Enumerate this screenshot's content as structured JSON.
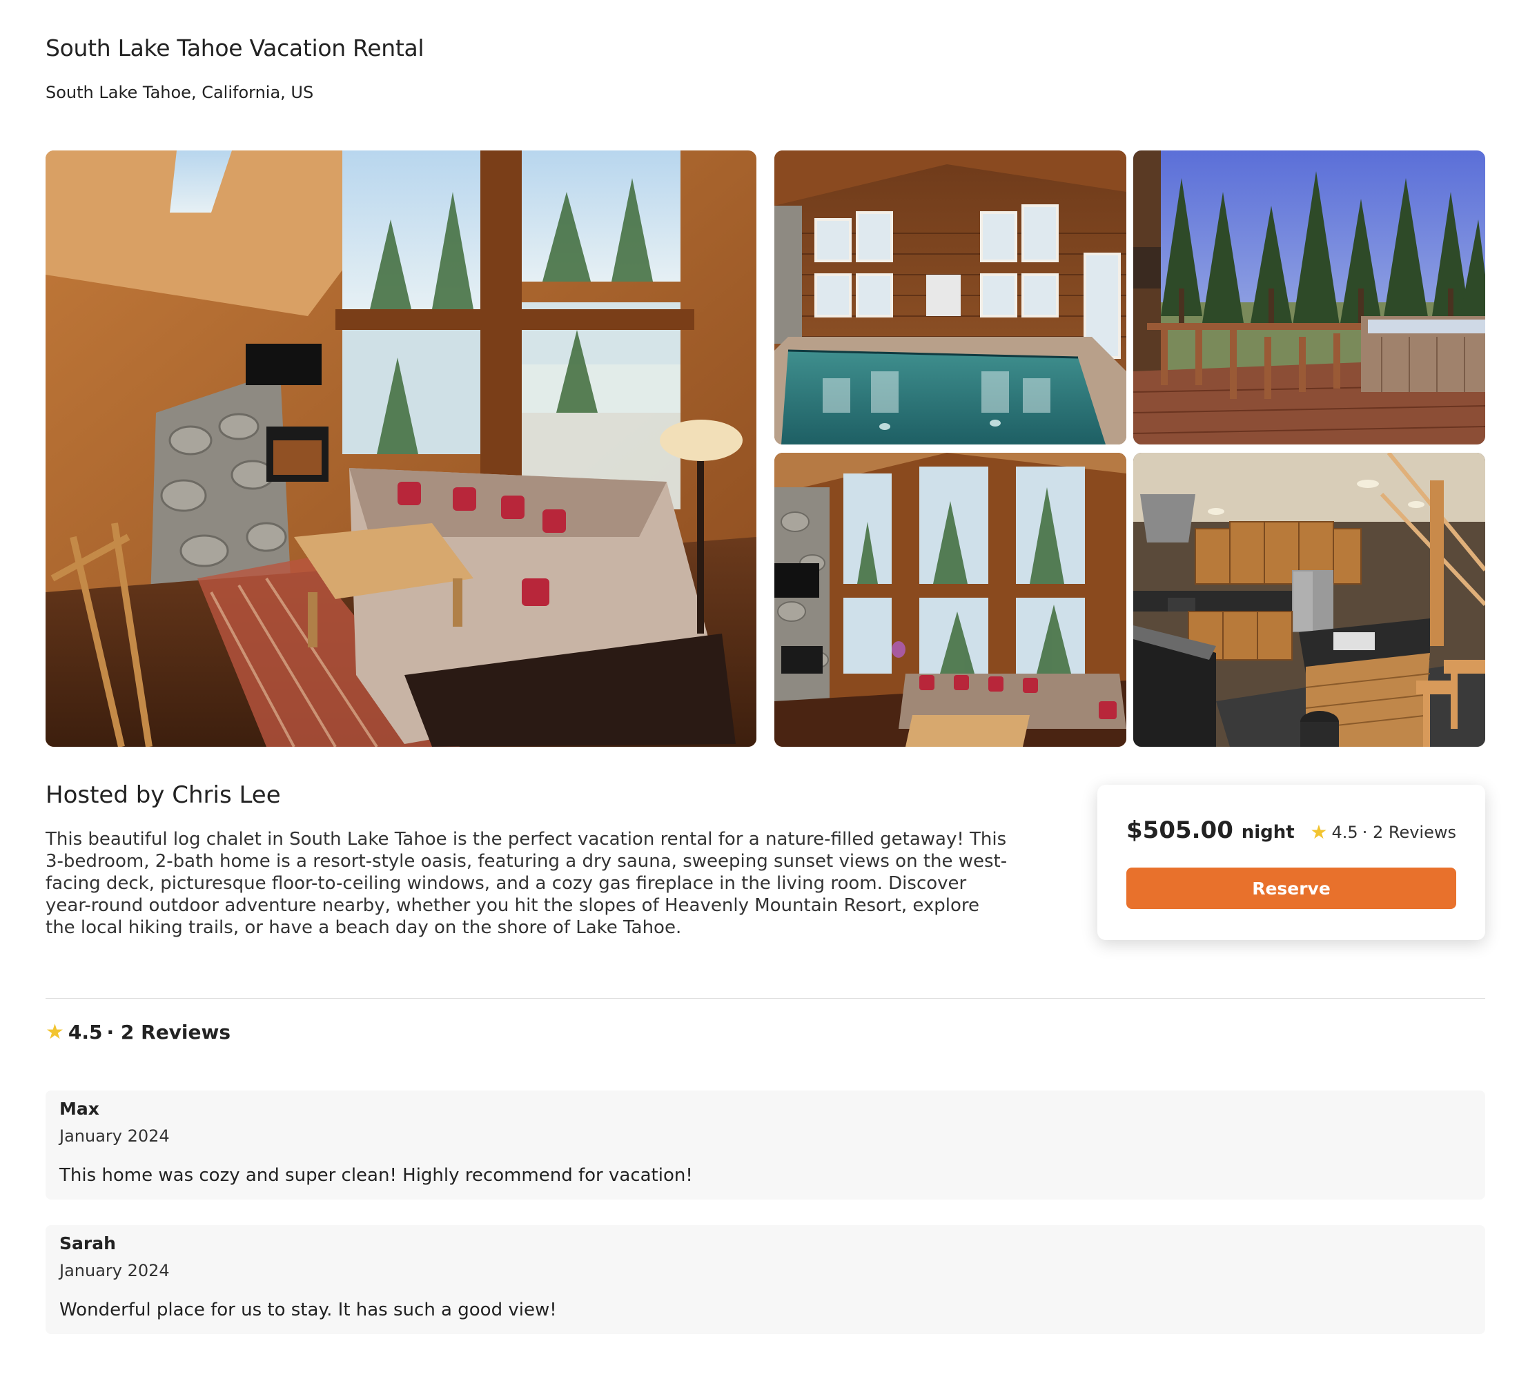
{
  "listing": {
    "title": "South Lake Tahoe Vacation Rental",
    "location": "South Lake Tahoe, California, US"
  },
  "gallery": {
    "photos": [
      "living-room",
      "indoor-pool",
      "deck-hot-tub",
      "living-room-windows",
      "kitchen"
    ]
  },
  "host": {
    "heading": "Hosted by Chris Lee",
    "description": "This beautiful log chalet in South Lake Tahoe is the perfect vacation rental for a nature-filled getaway! This 3-bedroom, 2-bath home is a resort-style oasis, featuring a dry sauna, sweeping sunset views on the west-facing deck, picturesque floor-to-ceiling windows, and a cozy gas fireplace in the living room. Discover year-round outdoor adventure nearby, whether you hit the slopes of Heavenly Mountain Resort, explore the local hiking trails, or have a beach day on the shore of Lake Tahoe."
  },
  "booking": {
    "price": "$505.00",
    "price_unit": "night",
    "rating": "4.5",
    "reviews_label": "· 2 Reviews",
    "reserve_label": "Reserve"
  },
  "reviews_section": {
    "rating": "4.5",
    "count_label": "· 2 Reviews",
    "items": [
      {
        "name": "Max",
        "date": "January 2024",
        "text": "This home was cozy and super clean! Highly recommend for vacation!"
      },
      {
        "name": "Sarah",
        "date": "January 2024",
        "text": "Wonderful place for us to stay. It has such a good view!"
      }
    ]
  },
  "icons": {
    "star": "star-icon"
  },
  "colors": {
    "accent": "#e8712c",
    "star": "#f2c430",
    "review_bg": "#f7f7f7"
  }
}
